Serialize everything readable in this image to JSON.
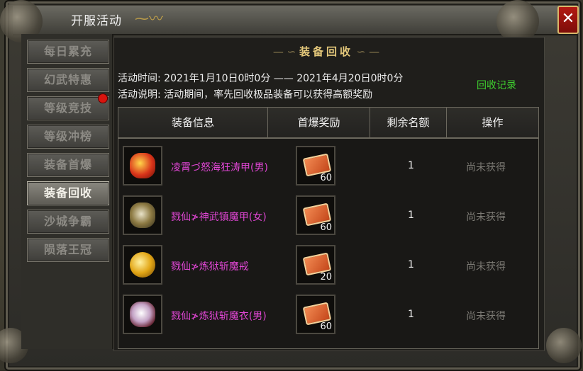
{
  "window": {
    "title": "开服活动",
    "close_label": "✕"
  },
  "sidebar": {
    "items": [
      {
        "label": "每日累充"
      },
      {
        "label": "幻武特惠"
      },
      {
        "label": "等级竞技"
      },
      {
        "label": "等级冲榜"
      },
      {
        "label": "装备首爆"
      },
      {
        "label": "装备回收"
      },
      {
        "label": "沙城争霸"
      },
      {
        "label": "陨落王冠"
      }
    ]
  },
  "main": {
    "section_title": "装备回收",
    "activity_time": "活动时间: 2021年1月10日0时0分  ——  2021年4月20日0时0分",
    "activity_desc": "活动说明: 活动期间，率先回收极品装备可以获得高额奖励",
    "record_link": "回收记录"
  },
  "table": {
    "headers": [
      "装备信息",
      "首爆奖励",
      "剩余名额",
      "操作"
    ],
    "rows": [
      {
        "name": "凌霄づ怒海狂涛甲(男)",
        "reward_count": "60",
        "remaining": "1",
        "status": "尚未获得"
      },
      {
        "name": "戮仙≯神武镇魔甲(女)",
        "reward_count": "60",
        "remaining": "1",
        "status": "尚未获得"
      },
      {
        "name": "戮仙≯炼狱斩魔戒",
        "reward_count": "20",
        "remaining": "1",
        "status": "尚未获得"
      },
      {
        "name": "戮仙≯炼狱斩魔衣(男)",
        "reward_count": "60",
        "remaining": "1",
        "status": "尚未获得"
      }
    ]
  },
  "colors": {
    "accent_gold": "#e3c77a",
    "item_name": "#e046d4",
    "link_green": "#3fd02f",
    "close_red": "#b31a12"
  }
}
